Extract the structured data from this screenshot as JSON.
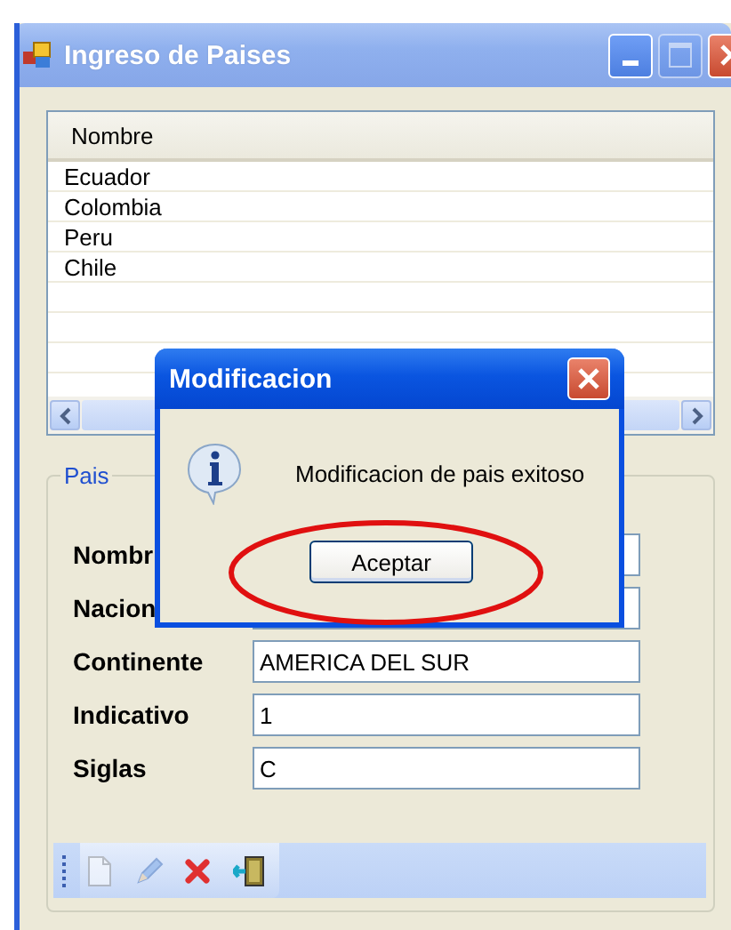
{
  "window": {
    "title": "Ingreso de Paises",
    "maximize_disabled": true
  },
  "list": {
    "columns": [
      "Nombre"
    ],
    "rows": [
      {
        "cells": [
          "Ecuador"
        ]
      },
      {
        "cells": [
          "Colombia"
        ]
      },
      {
        "cells": [
          "Peru"
        ]
      },
      {
        "cells": [
          "Chile"
        ]
      }
    ]
  },
  "group": {
    "title": "Pais",
    "fields": [
      {
        "label": "Nombr"
      },
      {
        "label": "Nacion"
      },
      {
        "label": "Continente",
        "value": "AMERICA DEL SUR"
      },
      {
        "label": "Indicativo",
        "value": "1"
      },
      {
        "label": "Siglas",
        "value": "C"
      }
    ]
  },
  "toolbar": [
    {
      "kind": "new",
      "disabled": true
    },
    {
      "kind": "edit",
      "disabled": true
    },
    {
      "kind": "delete",
      "disabled": false
    },
    {
      "kind": "exit",
      "disabled": false
    }
  ],
  "dialog": {
    "title": "Modificacion",
    "message": "Modificacion de pais exitoso",
    "button": "Aceptar",
    "highlighted": true
  }
}
